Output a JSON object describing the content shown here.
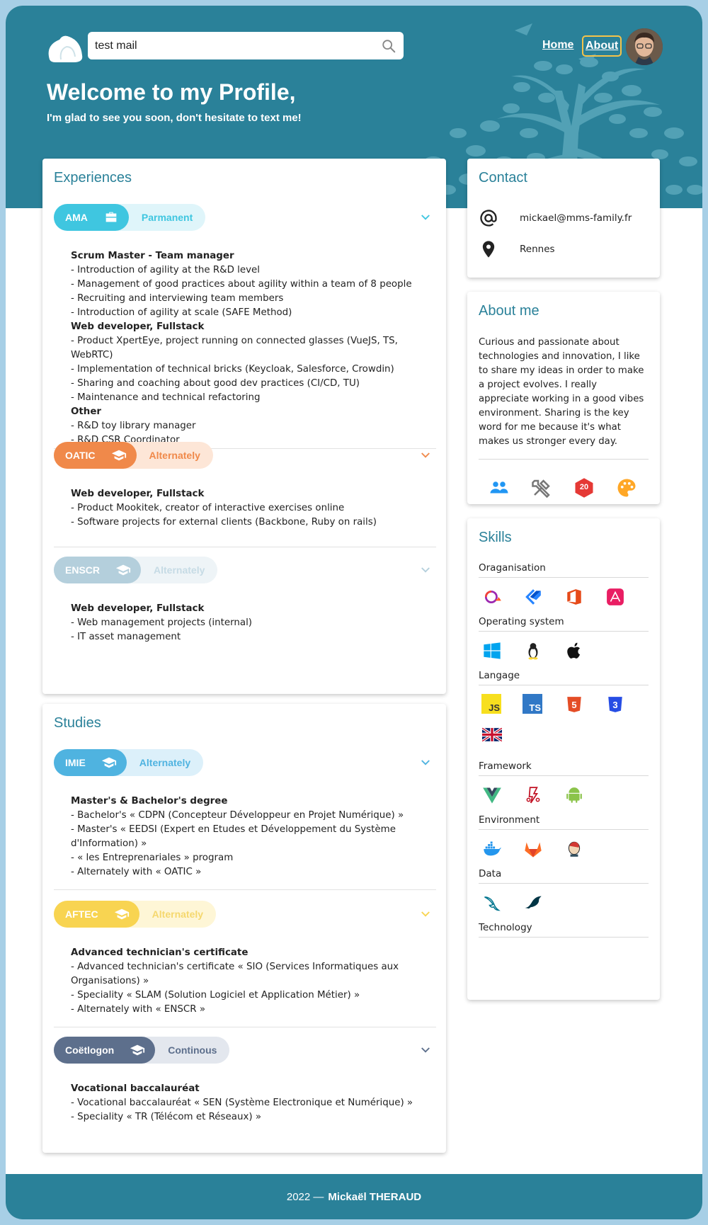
{
  "header": {
    "search_value": "test mail",
    "nav_home": "Home",
    "nav_about": "About",
    "title": "Welcome to my Profile,",
    "subtitle": "I'm glad to see you soon, don't hesitate to text me!"
  },
  "experiences": {
    "title": "Experiences",
    "items": [
      {
        "name": "AMA",
        "type": "Parmanent",
        "icon": "briefcase-icon",
        "lines": [
          {
            "t": "Scrum Master - Team manager",
            "b": true
          },
          {
            "t": "- Introduction of agility at the R&D level",
            "b": false
          },
          {
            "t": "- Management of good practices about agility within a team of 8 people",
            "b": false
          },
          {
            "t": "- Recruiting and interviewing team members",
            "b": false
          },
          {
            "t": "- Introduction of agility at scale (SAFE Method)",
            "b": false
          },
          {
            "t": "Web developer, Fullstack",
            "b": true
          },
          {
            "t": "- Product XpertEye, project running on connected glasses (VueJS, TS, WebRTC)",
            "b": false
          },
          {
            "t": "- Implementation of technical bricks (Keycloak, Salesforce, Crowdin)",
            "b": false
          },
          {
            "t": "- Sharing and coaching about good dev practices (CI/CD, TU)",
            "b": false
          },
          {
            "t": "- Maintenance and technical refactoring",
            "b": false
          },
          {
            "t": "Other",
            "b": true
          },
          {
            "t": "- R&D toy library manager",
            "b": false
          },
          {
            "t": "- R&D CSR Coordinator",
            "b": false
          }
        ]
      },
      {
        "name": "OATIC",
        "type": "Alternately",
        "icon": "graduation-cap-icon",
        "lines": [
          {
            "t": "Web developer, Fullstack",
            "b": true
          },
          {
            "t": "- Product Mookitek, creator of interactive exercises online",
            "b": false
          },
          {
            "t": "- Software projects for external clients (Backbone, Ruby on rails)",
            "b": false
          }
        ]
      },
      {
        "name": "ENSCR",
        "type": "Alternately",
        "icon": "graduation-cap-icon",
        "lines": [
          {
            "t": "Web developer, Fullstack",
            "b": true
          },
          {
            "t": "- Web management projects (internal)",
            "b": false
          },
          {
            "t": "- IT asset management",
            "b": false
          }
        ]
      }
    ]
  },
  "studies": {
    "title": "Studies",
    "items": [
      {
        "name": "IMIE",
        "type": "Alternately",
        "icon": "graduation-cap-icon",
        "lines": [
          {
            "t": "Master's & Bachelor's degree",
            "b": true
          },
          {
            "t": "- Bachelor's « CDPN (Concepteur Développeur en Projet Numérique) »",
            "b": false
          },
          {
            "t": "- Master's « EEDSI (Expert en Etudes et Développement du Système d'Information) »",
            "b": false
          },
          {
            "t": "- « les Entreprenariales » program",
            "b": false
          },
          {
            "t": "- Alternately with « OATIC »",
            "b": false
          }
        ]
      },
      {
        "name": "AFTEC",
        "type": "Alternately",
        "icon": "graduation-cap-icon",
        "lines": [
          {
            "t": "Advanced technician's certificate",
            "b": true
          },
          {
            "t": "- Advanced technician's certificate « SIO (Services Informatiques aux Organisations) »",
            "b": false
          },
          {
            "t": "- Speciality « SLAM (Solution Logiciel et Application Métier) »",
            "b": false
          },
          {
            "t": "- Alternately with « ENSCR »",
            "b": false
          }
        ]
      },
      {
        "name": "Coëtlogon",
        "type": "Continous",
        "icon": "graduation-cap-icon",
        "lines": [
          {
            "t": "Vocational baccalauréat",
            "b": true
          },
          {
            "t": "- Vocational baccalauréat « SEN (Système Electronique et Numérique) »",
            "b": false
          },
          {
            "t": "- Speciality « TR (Télécom et Réseaux) »",
            "b": false
          }
        ]
      }
    ]
  },
  "contact": {
    "title": "Contact",
    "email": "mickael@mms-family.fr",
    "city": "Rennes"
  },
  "about": {
    "title": "About me",
    "text": "Curious and passionate about technologies and innovation, I like to share my ideas in order to make a project evolves. I really appreciate working in a good vibes environment. Sharing is the key word for me because it's what makes us stronger every day.",
    "hobby_icons": [
      "people-icon",
      "tools-icon",
      "d20-dice-icon",
      "palette-icon"
    ],
    "dice_label": "20"
  },
  "skills": {
    "title": "Skills",
    "categories": {
      "organisation": "Oraganisation",
      "os": "Operating system",
      "language": "Langage",
      "framework": "Framework",
      "environment": "Environment",
      "data": "Data",
      "technology": "Technology"
    },
    "icon_labels": {
      "js": "JS",
      "ts": "TS",
      "html5": "5",
      "css3": "3"
    }
  },
  "footer": {
    "year": "2022 —",
    "author": "Mickaël THERAUD"
  },
  "colors": {
    "primary": "#2a8199",
    "ama": "#3fc6e0",
    "oatic": "#f0894a",
    "enscr": "#b4cfdc",
    "imie": "#4fb3e0",
    "aftec": "#f8d451",
    "coetlogon": "#5d6f8c"
  }
}
